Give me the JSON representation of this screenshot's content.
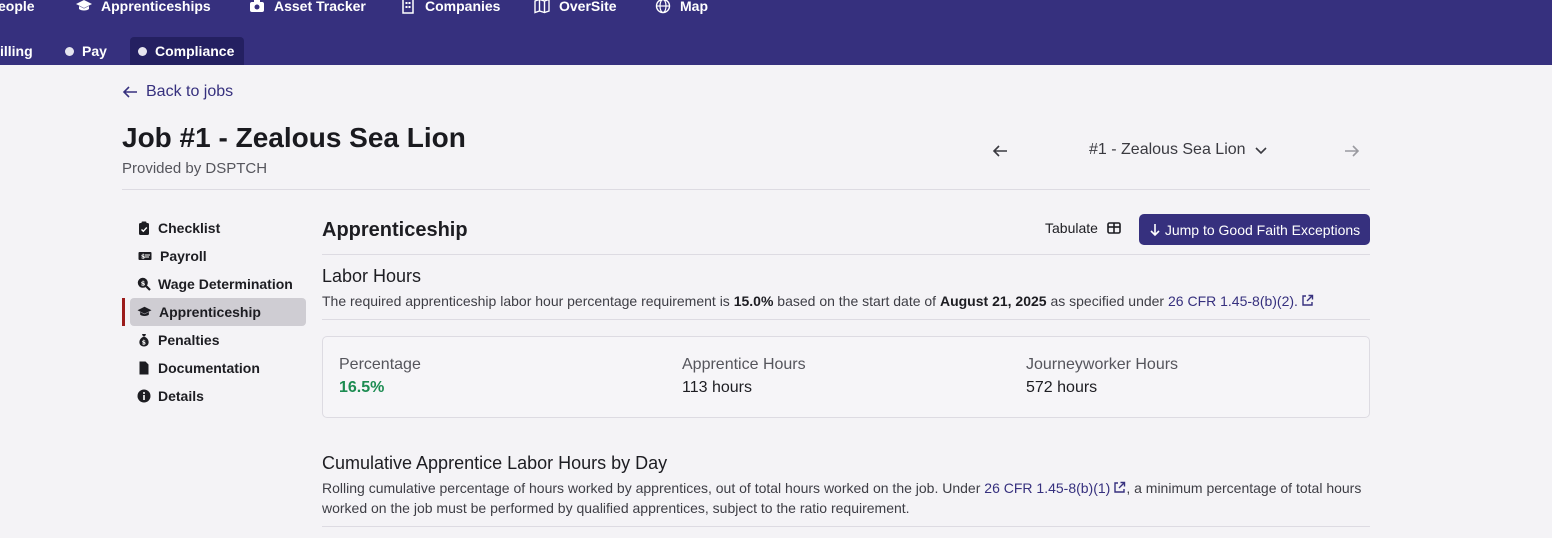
{
  "top_nav": [
    {
      "label": "eople",
      "icon": "people-icon"
    },
    {
      "label": "Apprenticeships",
      "icon": "graduation-cap-icon"
    },
    {
      "label": "Asset Tracker",
      "icon": "camera-icon"
    },
    {
      "label": "Companies",
      "icon": "building-icon"
    },
    {
      "label": "OverSite",
      "icon": "map-fold-icon"
    },
    {
      "label": "Map",
      "icon": "globe-icon"
    }
  ],
  "sub_nav": [
    {
      "label": "illing"
    },
    {
      "label": "Pay"
    },
    {
      "label": "Compliance",
      "active": true
    }
  ],
  "back_link": "Back to jobs",
  "job": {
    "title": "Job #1 - Zealous Sea Lion",
    "provider": "Provided by DSPTCH",
    "selector_value": "#1 - Zealous Sea Lion"
  },
  "sidebar": [
    {
      "label": "Checklist",
      "icon": "clipboard-check-icon"
    },
    {
      "label": "Payroll",
      "icon": "money-check-icon"
    },
    {
      "label": "Wage Determination",
      "icon": "magnifier-dollar-icon"
    },
    {
      "label": "Apprenticeship",
      "icon": "graduation-cap-icon",
      "active": true
    },
    {
      "label": "Penalties",
      "icon": "money-bag-icon"
    },
    {
      "label": "Documentation",
      "icon": "file-icon"
    },
    {
      "label": "Details",
      "icon": "info-circle-icon"
    }
  ],
  "section": {
    "title": "Apprenticeship",
    "tabulate_label": "Tabulate",
    "jump_button": "Jump to Good Faith Exceptions"
  },
  "labor_hours": {
    "title": "Labor Hours",
    "desc_prefix": "The required apprenticeship labor hour percentage requirement is",
    "required_pct": "15.0%",
    "desc_mid": "based on the start date of",
    "start_date": "August 21, 2025",
    "desc_suffix": "as specified under",
    "cfr_link": "26 CFR 1.45-8(b)(2)."
  },
  "stats": [
    {
      "label": "Percentage",
      "value": "16.5%"
    },
    {
      "label": "Apprentice Hours",
      "value": "113 hours"
    },
    {
      "label": "Journeyworker Hours",
      "value": "572 hours"
    }
  ],
  "cumulative": {
    "title": "Cumulative Apprentice Labor Hours by Day",
    "desc_prefix": "Rolling cumulative percentage of hours worked by apprentices, out of total hours worked on the job. Under",
    "cfr_link": "26 CFR 1.45-8(b)(1)",
    "desc_suffix": ", a minimum percentage of total hours worked on the job must be performed by qualified apprentices, subject to the ratio requirement."
  },
  "colors": {
    "nav_bg": "#36307e",
    "accent": "#36307e",
    "good": "#1d8c52",
    "active_bar": "#9b1b1b"
  }
}
